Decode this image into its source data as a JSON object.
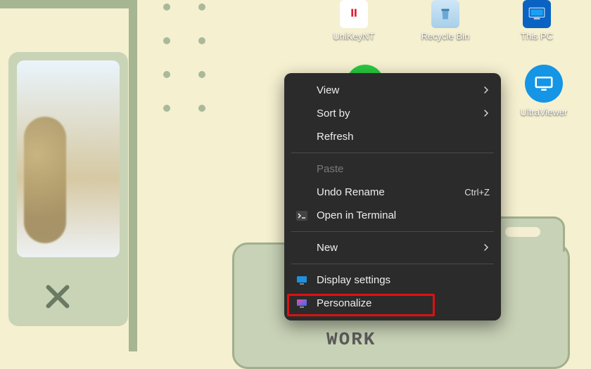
{
  "desktop_icons": [
    {
      "label": "UniKeyNT"
    },
    {
      "label": "Recycle Bin"
    },
    {
      "label": "This PC"
    }
  ],
  "ultraviewer_label": "UltraViewer",
  "work_label": "WORK",
  "context_menu": {
    "view": "View",
    "sort_by": "Sort by",
    "refresh": "Refresh",
    "paste": "Paste",
    "undo_rename": "Undo Rename",
    "undo_shortcut": "Ctrl+Z",
    "open_terminal": "Open in Terminal",
    "new": "New",
    "display_settings": "Display settings",
    "personalize": "Personalize"
  }
}
